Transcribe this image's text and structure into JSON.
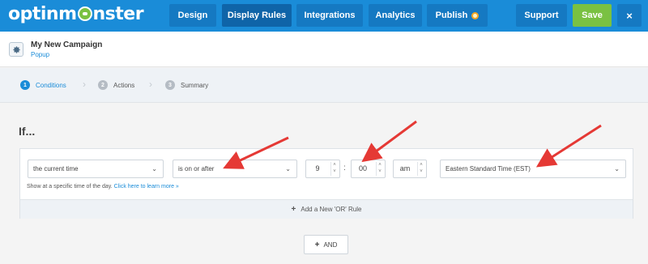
{
  "header": {
    "logo_text_left": "optinm",
    "logo_text_right": "nster",
    "nav": [
      {
        "label": "Design"
      },
      {
        "label": "Display Rules"
      },
      {
        "label": "Integrations"
      },
      {
        "label": "Analytics"
      },
      {
        "label": "Publish"
      }
    ],
    "support_label": "Support",
    "save_label": "Save",
    "close_label": "×",
    "brand_color": "#1a8cd8",
    "save_color": "#7ac142"
  },
  "campaign": {
    "name": "My New Campaign",
    "type": "Popup"
  },
  "steps": [
    {
      "number": "1",
      "label": "Conditions"
    },
    {
      "number": "2",
      "label": "Actions"
    },
    {
      "number": "3",
      "label": "Summary"
    }
  ],
  "rule": {
    "if_label": "If...",
    "condition": "the current time",
    "operator": "is on or after",
    "hour": "9",
    "minute": "00",
    "meridiem": "am",
    "timezone": "Eastern Standard Time (EST)",
    "helper_text": "Show at a specific time of the day.",
    "helper_link": "Click here to learn more »",
    "add_or_label": "Add a New 'OR' Rule",
    "and_label": "AND"
  },
  "annotation_color": "#e53935"
}
